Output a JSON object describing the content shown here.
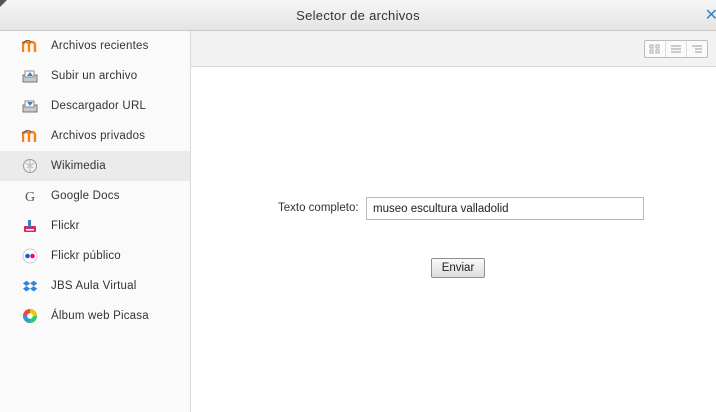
{
  "dialog": {
    "title": "Selector de archivos",
    "close_icon": "close-icon"
  },
  "sidebar": {
    "items": [
      {
        "label": "Archivos recientes",
        "icon": "moodle-icon"
      },
      {
        "label": "Subir un archivo",
        "icon": "upload-icon"
      },
      {
        "label": "Descargador URL",
        "icon": "download-icon"
      },
      {
        "label": "Archivos privados",
        "icon": "moodle-icon"
      },
      {
        "label": "Wikimedia",
        "icon": "wikimedia-icon",
        "active": true
      },
      {
        "label": "Google Docs",
        "icon": "google-icon"
      },
      {
        "label": "Flickr",
        "icon": "flickr-icon"
      },
      {
        "label": "Flickr público",
        "icon": "flickr-public-icon"
      },
      {
        "label": "JBS Aula Virtual",
        "icon": "dropbox-icon"
      },
      {
        "label": "Álbum web Picasa",
        "icon": "picasa-icon"
      }
    ]
  },
  "toolbar": {
    "view_icons": [
      "grid-view-icon",
      "list-view-icon",
      "tree-view-icon"
    ]
  },
  "search": {
    "label": "Texto completo:",
    "value": "museo escultura valladolid",
    "submit_label": "Enviar"
  },
  "colors": {
    "accent": "#3a87c8",
    "active_item_bg": "#ebebeb",
    "moodle_orange": "#f98012"
  }
}
